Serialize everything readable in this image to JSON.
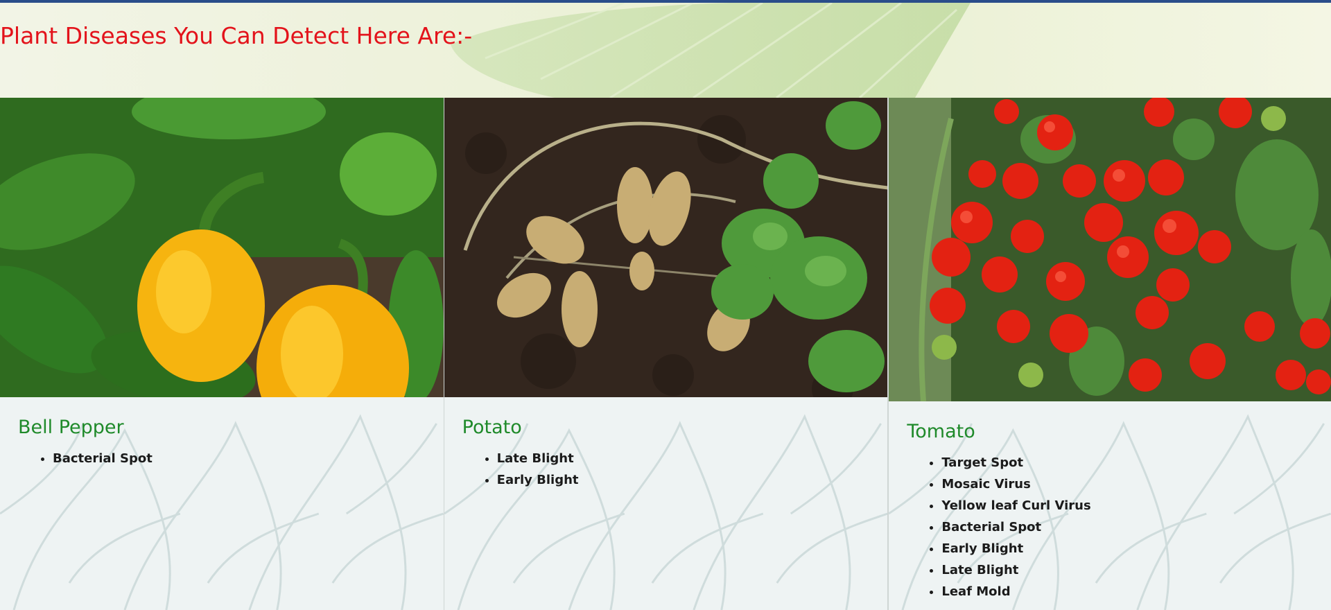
{
  "header": {
    "title": "Plant Diseases You Can Detect Here Are:-"
  },
  "colors": {
    "title": "#e3131b",
    "crop_name": "#1f8a2a",
    "top_bar": "#2a4d8a"
  },
  "crops": [
    {
      "name": "Bell Pepper",
      "image_icon": "bell-pepper-photo",
      "diseases": [
        "Bacterial Spot"
      ]
    },
    {
      "name": "Potato",
      "image_icon": "potato-photo",
      "diseases": [
        "Late Blight",
        "Early Blight"
      ]
    },
    {
      "name": "Tomato",
      "image_icon": "tomato-photo",
      "diseases": [
        "Target Spot",
        "Mosaic Virus",
        "Yellow leaf Curl Virus",
        "Bacterial Spot",
        "Early Blight",
        "Late Blight",
        "Leaf Mold"
      ]
    }
  ]
}
